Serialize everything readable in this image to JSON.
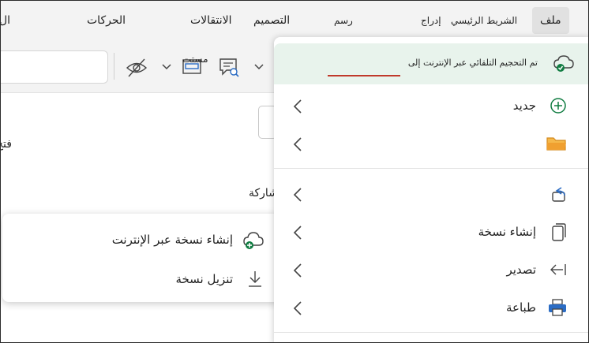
{
  "tabs": {
    "file": "ملف",
    "home": "الشريط الرئيسي",
    "insert": "إدراج",
    "draw": "رسم",
    "design": "التصميم",
    "transitions": "الانتقالات",
    "animations": "الحركات",
    "slideshow": "ال"
  },
  "toolbar": {
    "partial_label": "مستت"
  },
  "background": {
    "partial_open": "فتح",
    "share": "مشاركة"
  },
  "popup": {
    "items": [
      {
        "label": "إنشاء نسخة عبر الإنترنت",
        "icon": "cloud-add-icon"
      },
      {
        "label": "تنزيل نسخة",
        "icon": "download-icon"
      }
    ]
  },
  "file_menu": {
    "banner_text": "تم التحجيم التلقائي عبر الإنترنت إلى",
    "items": {
      "new": "جديد",
      "open": "",
      "share": "",
      "create_copy": "إنشاء نسخة",
      "export": "تصدير",
      "print": "طباعة"
    }
  },
  "colors": {
    "accent_green": "#107c41",
    "folder_orange": "#f0a030",
    "share_blue": "#2b6cc4",
    "banner_bg": "#e8f3ec"
  }
}
